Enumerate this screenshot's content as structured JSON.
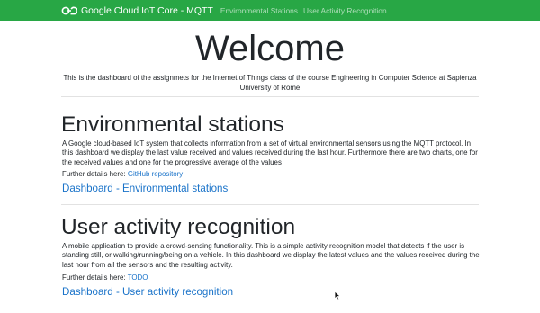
{
  "navbar": {
    "brand": "Google Cloud IoT Core - MQTT",
    "brand_icon": "cloud-link-icon",
    "links": [
      "Environmental Stations",
      "User Activity Recognition"
    ],
    "color": "#28a745"
  },
  "welcome": {
    "title": "Welcome",
    "lead": "This is the dashboard of the assignmets for the Internet of Things class of the course Engineering in Computer Science at Sapienza University of Rome"
  },
  "env": {
    "heading": "Environmental stations",
    "text": "A Google cloud-based IoT system that collects information from a set of virtual environmental sensors using the MQTT protocol. In this dashboard we display the last value received and values received during the last hour. Furthermore there are two charts, one for the received values and one for the progressive average of the values",
    "details_label": "Further details here:",
    "details_link": "GitHub repository",
    "dashboard_link": "Dashboard - Environmental stations"
  },
  "user": {
    "heading": "User activity recognition",
    "text": "A mobile application to provide a crowd-sensing functionality. This is a simple activity recognition model that detects if the user is standing still, or walking/running/being on a vehicle. In this dashboard we display the latest values and the values received during the last hour from all the sensors and the resulting activity.",
    "details_label": "Further details here:",
    "details_link": "TODO",
    "dashboard_link": "Dashboard - User activity recognition"
  },
  "colors": {
    "link": "#1a73c9",
    "text": "#212529"
  }
}
